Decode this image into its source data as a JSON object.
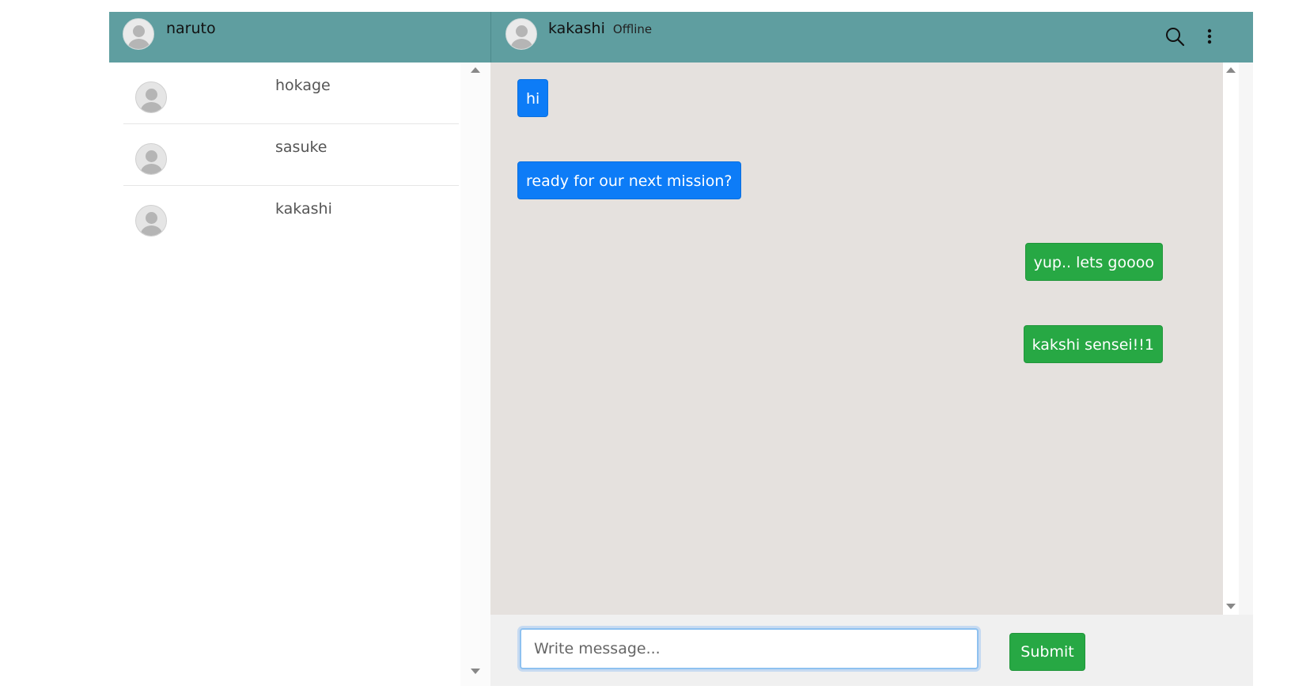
{
  "sidebar": {
    "user_name": "naruto",
    "contacts": [
      {
        "name": "hokage"
      },
      {
        "name": "sasuke"
      },
      {
        "name": "kakashi"
      }
    ]
  },
  "chat": {
    "contact_name": "kakashi",
    "status": "Offline",
    "messages": [
      {
        "direction": "incoming",
        "text": "hi"
      },
      {
        "direction": "incoming",
        "text": "ready for our next mission?"
      },
      {
        "direction": "outgoing",
        "text": "yup.. lets goooo"
      },
      {
        "direction": "outgoing",
        "text": "kakshi sensei!!1"
      }
    ]
  },
  "composer": {
    "placeholder": "Write message...",
    "submit_label": "Submit"
  },
  "icons": {
    "search": "search-icon",
    "more": "more-vertical-icon"
  },
  "colors": {
    "header": "#5f9ea0",
    "incoming": "#0d7cf7",
    "outgoing": "#27a844",
    "chat_bg": "#e5e1de"
  }
}
